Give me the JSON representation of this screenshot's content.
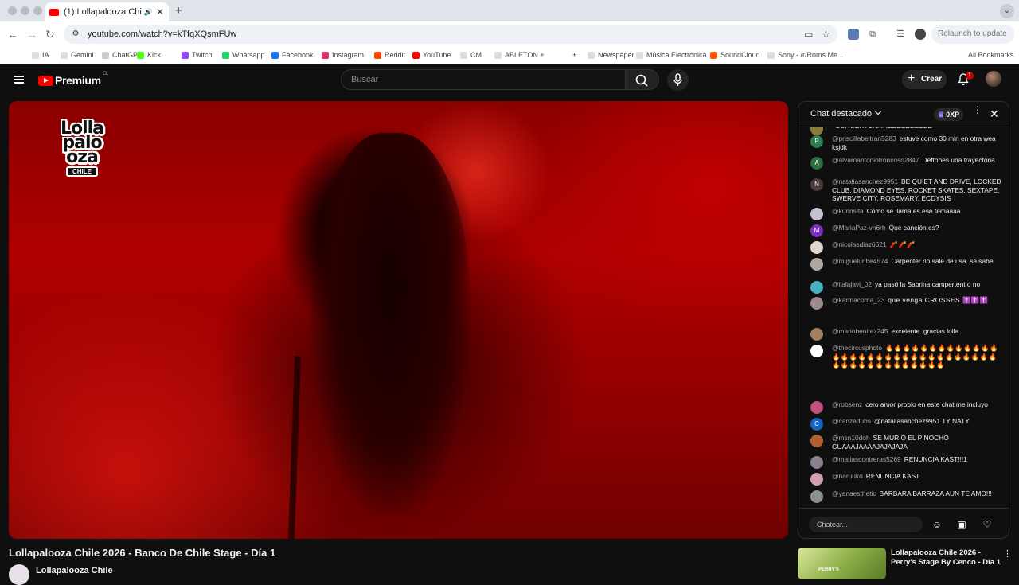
{
  "browser": {
    "tab_title": "(1) Lollapalooza Chile 2026",
    "url": "youtube.com/watch?v=kTfqXQsmFUw",
    "relaunch_label": "Relaunch to update",
    "bookmarks": [
      {
        "label": "IA",
        "color": "#dddddd"
      },
      {
        "label": "Gemini",
        "color": "#dddddd"
      },
      {
        "label": "ChatGPT",
        "color": "#cccccc"
      },
      {
        "label": "Kick",
        "color": "#53fc18"
      },
      {
        "label": "Twitch",
        "color": "#9146ff"
      },
      {
        "label": "Whatsapp",
        "color": "#25d366"
      },
      {
        "label": "Facebook",
        "color": "#1877f2"
      },
      {
        "label": "Instagram",
        "color": "#e1306c"
      },
      {
        "label": "Reddit",
        "color": "#ff4500"
      },
      {
        "label": "YouTube",
        "color": "#ff0000"
      },
      {
        "label": "CM",
        "color": "#dddddd"
      },
      {
        "label": "ABLETON +",
        "color": "#dddddd"
      },
      {
        "label": "+",
        "color": "#ffffff"
      },
      {
        "label": "Newspaper",
        "color": "#dddddd"
      },
      {
        "label": "Música Electrónica",
        "color": "#dddddd"
      },
      {
        "label": "SoundCloud",
        "color": "#ff5500"
      },
      {
        "label": "Sony - /r/Roms Me...",
        "color": "#dddddd"
      }
    ],
    "all_bookmarks": "All Bookmarks"
  },
  "youtube": {
    "logo_text": "Premium",
    "country": "CL",
    "search_placeholder": "Buscar",
    "create_label": "Crear",
    "notif_count": "1",
    "video_title": "Lollapalooza Chile 2026 - Banco De Chile Stage - Día 1",
    "channel_name": "Lollapalooza Chile",
    "video_logo": {
      "line1": "Lolla",
      "line2": "palo",
      "line3": "oza",
      "tag": "CHILE"
    }
  },
  "chat": {
    "header": "Chat destacado",
    "xp": "0XP",
    "input_placeholder": "Chatear...",
    "messages": [
      {
        "author": "",
        "text": "CONCEHTUAMREEEEEEEEEE",
        "av": "",
        "avc": "#8a7a3a"
      },
      {
        "author": "@priscillabeltran5283",
        "text": "estuve como 30 min en otra wea ksjdk",
        "av": "P",
        "avc": "#2e7d4f"
      },
      {
        "author": "@alvaroantoniotroncoso2847",
        "text": "Deftones una trayectoria",
        "av": "A",
        "avc": "#2e6e3e"
      },
      {
        "author": "@nataliasanchez9951",
        "text": "BE QUIET AND DRIVE, LOCKED CLUB, DIAMOND EYES, ROCKET SKATES, SEXTAPE, SWERVE CITY, ROSEMARY, ECDYSIS",
        "av": "N",
        "avc": "#4a3a3a"
      },
      {
        "author": "@kurinsita",
        "text": "Cómo se llama es ese temaaaa",
        "av": "",
        "avc": "#c8c0d0"
      },
      {
        "author": "@MariaPaz-vn6rh",
        "text": "Qué canción es?",
        "av": "M",
        "avc": "#7b2fbf"
      },
      {
        "author": "@nicolasdiaz6621",
        "text": "🧨🧨🧨",
        "av": "",
        "avc": "#e0d8d0"
      },
      {
        "author": "@migueluribe4574",
        "text": "Carpenter no sale de usa. se sabe",
        "av": "",
        "avc": "#b0a8a0"
      },
      {
        "author": "@ilalajavi_02",
        "text": "ya pasó la Sabrina campertent o no",
        "av": "",
        "avc": "#4ab0c0"
      },
      {
        "author": "@karmacoma_23",
        "text": "que venga CROSSES ✝️✝️✝️",
        "av": "",
        "avc": "#9a8a8a"
      },
      {
        "author": "@mariobenitez245",
        "text": "excelente..gracias lolla",
        "av": "",
        "avc": "#a08060"
      },
      {
        "author": "@thecircusphoto",
        "text": "🔥🔥🔥🔥🔥🔥🔥🔥🔥🔥🔥🔥🔥🔥🔥🔥🔥🔥🔥🔥🔥🔥🔥🔥🔥🔥🔥🔥🔥🔥🔥🔥🔥🔥🔥🔥🔥🔥🔥🔥🔥🔥🔥🔥🔥",
        "av": "",
        "avc": "#ffffff"
      },
      {
        "author": "@robsenz",
        "text": "cero amor propio en este chat me incluyo",
        "av": "",
        "avc": "#c05080"
      },
      {
        "author": "@canzadubs",
        "text": "@nataliasanchez9951 TY NATY",
        "av": "C",
        "avc": "#1565c0"
      },
      {
        "author": "@msn10doh",
        "text": "SE MURIÓ EL PINOCHO GUAAAJAAAAJAJAJAJA",
        "av": "",
        "avc": "#b06030"
      },
      {
        "author": "@matiascontreras5269",
        "text": "RENUNCIA KAST!!!1",
        "av": "",
        "avc": "#8a8090"
      },
      {
        "author": "@naruuko",
        "text": "RENUNCIA KAST",
        "av": "",
        "avc": "#d0a0b0"
      },
      {
        "author": "@yanaesthetic",
        "text": "BARBARA BARRAZA AUN TE AMO!!!",
        "av": "",
        "avc": "#909090"
      }
    ]
  },
  "related": {
    "title": "Lollapalooza Chile 2026 - Perry's Stage By Cenco - Día 1",
    "thumb_label": "PERRY'S"
  }
}
